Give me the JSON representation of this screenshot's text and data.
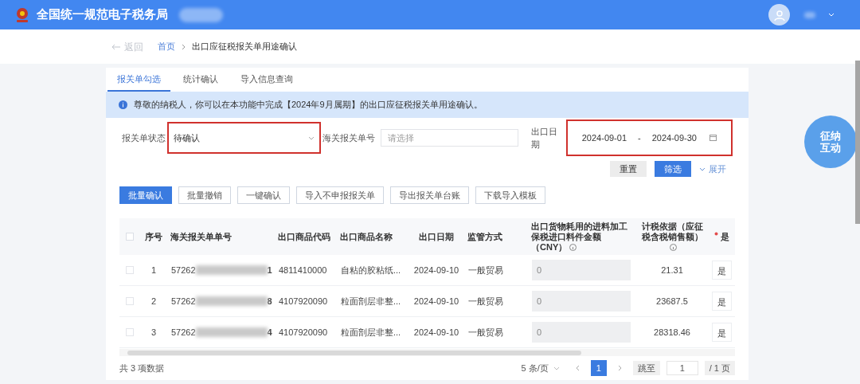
{
  "header": {
    "title": "全国统一规范电子税务局"
  },
  "breadcrumb": {
    "back": "返回",
    "items": [
      "首页",
      "出口应征税报关单用途确认"
    ]
  },
  "tabs": [
    {
      "label": "报关单勾选",
      "selected": true
    },
    {
      "label": "统计确认",
      "selected": false
    },
    {
      "label": "导入信息查询",
      "selected": false
    }
  ],
  "notice": "尊敬的纳税人，你可以在本功能中完成【2024年9月属期】的出口应征税报关单用途确认。",
  "filters": {
    "status": {
      "label": "报关单状态",
      "value": "待确认",
      "highlighted": true
    },
    "declaration_no": {
      "label": "海关报关单号",
      "placeholder": "请选择",
      "highlighted": false
    },
    "export_date": {
      "label": "出口日期",
      "start": "2024-09-01",
      "separator": "-",
      "end": "2024-09-30",
      "highlighted": true
    }
  },
  "filter_buttons": {
    "reset": "重置",
    "filter": "筛选",
    "expand": "展开"
  },
  "actions": [
    {
      "label": "批量确认",
      "primary": true
    },
    {
      "label": "批量撤销",
      "primary": false
    },
    {
      "label": "一键确认",
      "primary": false
    },
    {
      "label": "导入不申报报关单",
      "primary": false
    },
    {
      "label": "导出报关单台账",
      "primary": false
    },
    {
      "label": "下载导入模板",
      "primary": false
    }
  ],
  "table": {
    "header_checked": false,
    "columns": [
      {
        "label": "序号",
        "info": false,
        "required": false
      },
      {
        "label": "海关报关单单号",
        "info": false,
        "required": false
      },
      {
        "label": "出口商品代码",
        "info": false,
        "required": false
      },
      {
        "label": "出口商品名称",
        "info": false,
        "required": false
      },
      {
        "label": "出口日期",
        "info": false,
        "required": false
      },
      {
        "label": "监管方式",
        "info": false,
        "required": false
      },
      {
        "label": "出口货物耗用的进料加工保税进口料件金额（CNY）",
        "info": true,
        "required": false
      },
      {
        "label": "计税依据（应征税含税销售额）",
        "info": true,
        "required": false
      },
      {
        "label": "是",
        "info": false,
        "required": true
      }
    ],
    "rows": [
      {
        "checked": false,
        "no": "1",
        "id_prefix": "57262",
        "id_suffix": "1",
        "code": "4811410000",
        "name": "自粘的胶粘纸...",
        "date": "2024-09-10",
        "mode": "一般贸易",
        "amount": "0",
        "basis": "21.31",
        "choice": "是"
      },
      {
        "checked": false,
        "no": "2",
        "id_prefix": "57262",
        "id_suffix": "8",
        "code": "4107920090",
        "name": "粒面剖层非整...",
        "date": "2024-09-10",
        "mode": "一般贸易",
        "amount": "0",
        "basis": "23687.5",
        "choice": "是"
      },
      {
        "checked": false,
        "no": "3",
        "id_prefix": "57262",
        "id_suffix": "4",
        "code": "4107920090",
        "name": "粒面剖层非整...",
        "date": "2024-09-10",
        "mode": "一般贸易",
        "amount": "0",
        "basis": "28318.46",
        "choice": "是"
      }
    ]
  },
  "pagination": {
    "total": "共 3 项数据",
    "page_size": "5 条/页",
    "pages": [
      {
        "label": "1",
        "selected": true
      }
    ],
    "jump_label": "跳至",
    "jump_value": "1",
    "page_count": "/ 1 页"
  },
  "assistant": {
    "label": "征纳互动"
  }
}
